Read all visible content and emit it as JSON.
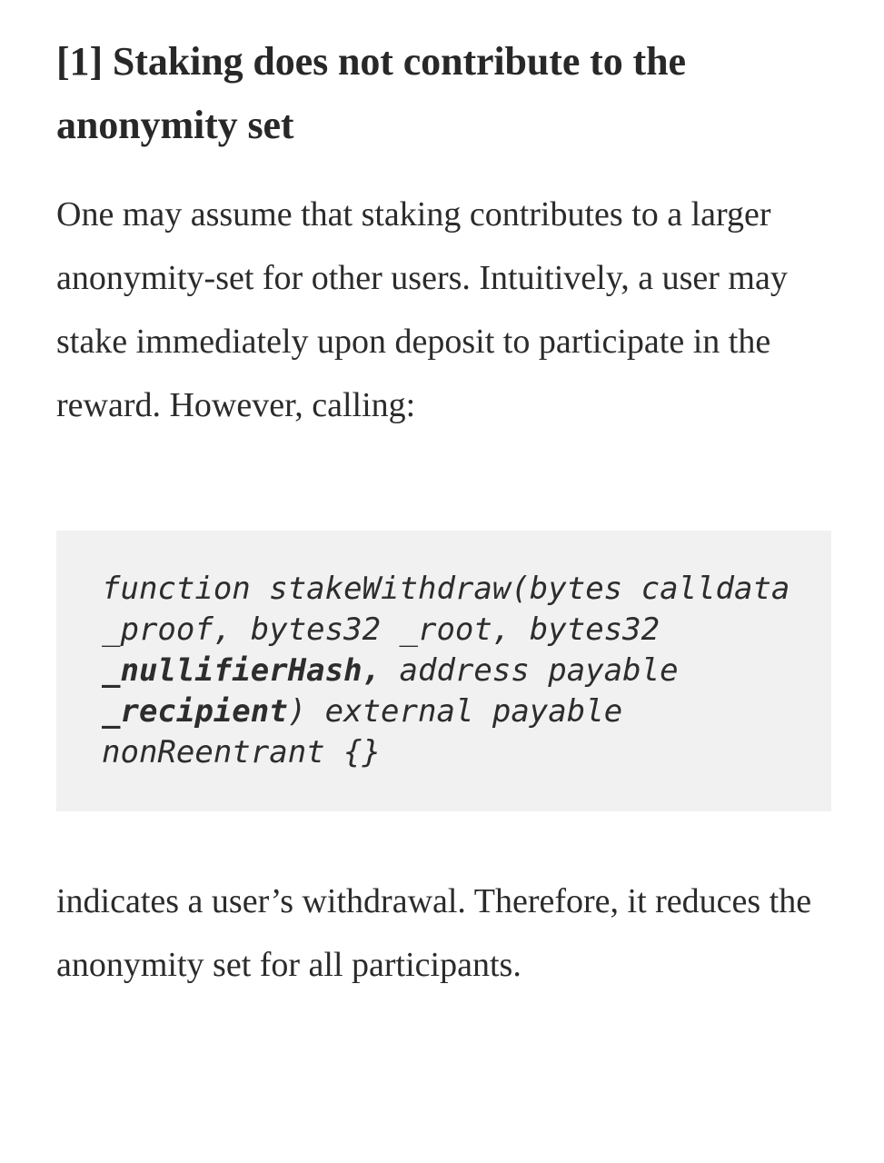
{
  "article": {
    "heading": "[1] Staking does not contribute to the anonymity set",
    "intro_paragraph": "One may assume that staking contributes to a larger anonymity-set for other users. Intuitively, a user may stake immediately upon deposit to participate in the reward. However, calling:",
    "code_block": {
      "language": "solidity",
      "line_1": "function stakeWithdraw(bytes calldata _proof, bytes32 _root, bytes32 ",
      "emphasis_1": "_nullifierHash,",
      "line_2": " address payable ",
      "emphasis_2": "_recipient",
      "line_3": ") external payable nonReentrant {}",
      "full_text": "function stakeWithdraw(bytes calldata _proof, bytes32 _root, bytes32 _nullifierHash, address payable _recipient) external payable nonReentrant {}",
      "background_color": "#f1f1f1"
    },
    "conclusion_paragraph": "indicates a user’s withdrawal. Therefore, it reduces the anonymity set for all participants."
  },
  "theme": {
    "page_background": "#ffffff",
    "text_color": "#2b2b2b",
    "heading_color": "#282828",
    "code_text_color": "#2d2d2d"
  }
}
